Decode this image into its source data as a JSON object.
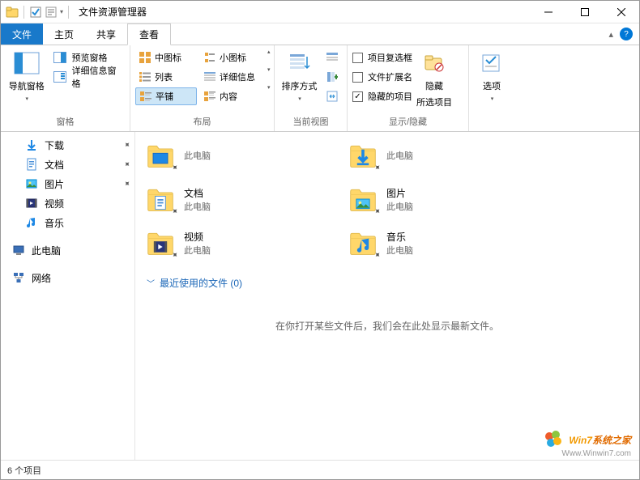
{
  "title": "文件资源管理器",
  "tabs": {
    "file": "文件",
    "home": "主页",
    "share": "共享",
    "view": "查看"
  },
  "ribbon": {
    "panes": {
      "label": "窗格",
      "nav": "导航窗格",
      "preview": "预览窗格",
      "details": "详细信息窗格"
    },
    "layout": {
      "label": "布局",
      "medium": "中图标",
      "small": "小图标",
      "list": "列表",
      "detailsv": "详细信息",
      "tiles": "平铺",
      "content": "内容"
    },
    "currentview": {
      "label": "当前视图",
      "sortby": "排序方式"
    },
    "showhide": {
      "label": "显示/隐藏",
      "checkboxes": "项目复选框",
      "extensions": "文件扩展名",
      "hidden": "隐藏的项目",
      "hidebtn": "隐藏",
      "hidebtn2": "所选项目"
    },
    "options": {
      "label": "选项"
    }
  },
  "nav": {
    "downloads": "下载",
    "documents": "文档",
    "pictures": "图片",
    "videos": "视频",
    "music": "音乐",
    "thispc": "此电脑",
    "network": "网络"
  },
  "items": [
    {
      "name": "",
      "sub": "此电脑",
      "kind": "desktop"
    },
    {
      "name": "",
      "sub": "此电脑",
      "kind": "downloads"
    },
    {
      "name": "文档",
      "sub": "此电脑",
      "kind": "documents"
    },
    {
      "name": "图片",
      "sub": "此电脑",
      "kind": "pictures"
    },
    {
      "name": "视频",
      "sub": "此电脑",
      "kind": "videos"
    },
    {
      "name": "音乐",
      "sub": "此电脑",
      "kind": "music"
    }
  ],
  "recent": {
    "header": "最近使用的文件 (0)",
    "empty": "在你打开某些文件后，我们会在此处显示最新文件。"
  },
  "status": "6 个项目",
  "watermark": {
    "line1a": "Win7",
    "line1b": "系统之家",
    "line2": "Www.Winwin7.com"
  }
}
